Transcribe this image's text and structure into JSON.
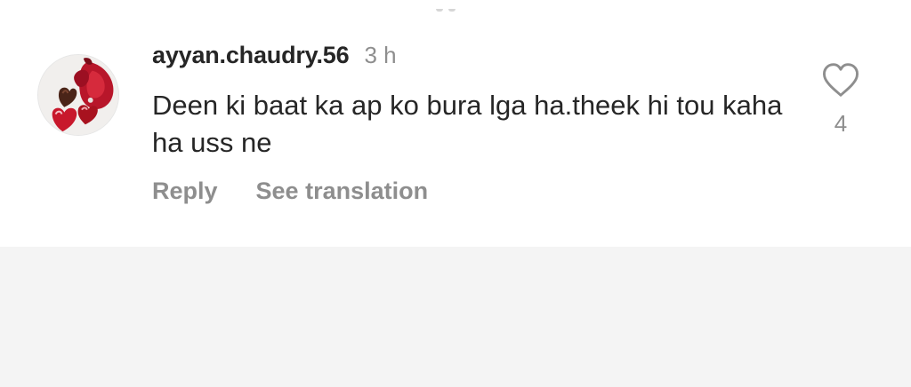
{
  "comment": {
    "username": "ayyan.chaudry.56",
    "time_ago": "3 h",
    "text": "Deen ki baat ka ap ko bura lga ha.theek hi tou kaha ha uss ne",
    "like_count": "4",
    "actions": {
      "reply": "Reply",
      "see_translation": "See translation"
    },
    "avatar_icon": "avatar-roses-hearts-icon",
    "like_icon": "heart-outline-icon"
  },
  "colors": {
    "primary_text": "#262626",
    "secondary_text": "#8e8e8e",
    "card_background": "#ffffff",
    "page_background": "#f4f4f4"
  }
}
